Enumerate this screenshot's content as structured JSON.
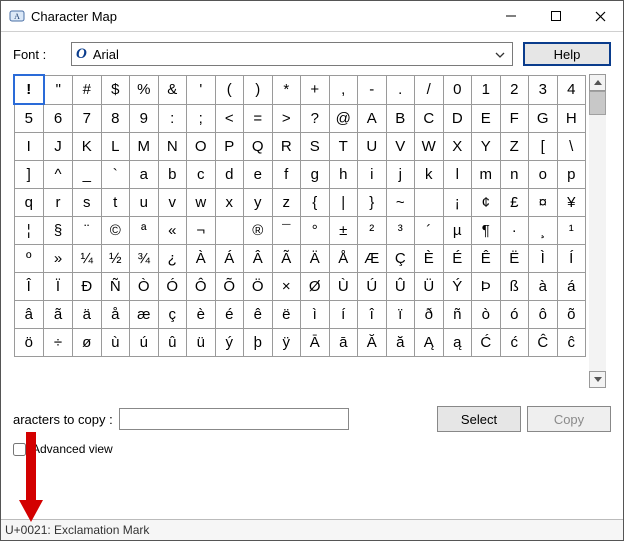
{
  "window": {
    "title": "Character Map"
  },
  "toolbar": {
    "font_label": "Font :",
    "font_name": "Arial",
    "help_label": "Help"
  },
  "grid": {
    "selected_index": 0,
    "rows": [
      [
        "!",
        "\"",
        "#",
        "$",
        "%",
        "&",
        "'",
        "(",
        ")",
        "*",
        "+",
        ",",
        "-",
        ".",
        "/",
        "0",
        "1",
        "2",
        "3",
        "4"
      ],
      [
        "5",
        "6",
        "7",
        "8",
        "9",
        ":",
        ";",
        "<",
        "=",
        ">",
        "?",
        "@",
        "A",
        "B",
        "C",
        "D",
        "E",
        "F",
        "G",
        "H"
      ],
      [
        "I",
        "J",
        "K",
        "L",
        "M",
        "N",
        "O",
        "P",
        "Q",
        "R",
        "S",
        "T",
        "U",
        "V",
        "W",
        "X",
        "Y",
        "Z",
        "[",
        "\\"
      ],
      [
        "]",
        "^",
        "_",
        "`",
        "a",
        "b",
        "c",
        "d",
        "e",
        "f",
        "g",
        "h",
        "i",
        "j",
        "k",
        "l",
        "m",
        "n",
        "o",
        "p"
      ],
      [
        "q",
        "r",
        "s",
        "t",
        "u",
        "v",
        "w",
        "x",
        "y",
        "z",
        "{",
        "|",
        "}",
        "~",
        "",
        "¡",
        "¢",
        "£",
        "¤",
        "¥"
      ],
      [
        "¦",
        "§",
        "¨",
        "©",
        "ª",
        "«",
        "¬",
        "­",
        "®",
        "¯",
        "°",
        "±",
        "²",
        "³",
        "´",
        "µ",
        "¶",
        "·",
        "¸",
        "¹"
      ],
      [
        "º",
        "»",
        "¼",
        "½",
        "¾",
        "¿",
        "À",
        "Á",
        "Â",
        "Ã",
        "Ä",
        "Å",
        "Æ",
        "Ç",
        "È",
        "É",
        "Ê",
        "Ë",
        "Ì",
        "Í"
      ],
      [
        "Î",
        "Ï",
        "Ð",
        "Ñ",
        "Ò",
        "Ó",
        "Ô",
        "Õ",
        "Ö",
        "×",
        "Ø",
        "Ù",
        "Ú",
        "Û",
        "Ü",
        "Ý",
        "Þ",
        "ß",
        "à",
        "á"
      ],
      [
        "â",
        "ã",
        "ä",
        "å",
        "æ",
        "ç",
        "è",
        "é",
        "ê",
        "ë",
        "ì",
        "í",
        "î",
        "ï",
        "ð",
        "ñ",
        "ò",
        "ó",
        "ô",
        "õ"
      ],
      [
        "ö",
        "÷",
        "ø",
        "ù",
        "ú",
        "û",
        "ü",
        "ý",
        "þ",
        "ÿ",
        "Ā",
        "ā",
        "Ă",
        "ă",
        "Ą",
        "ą",
        "Ć",
        "ć",
        "Ĉ",
        "ĉ"
      ]
    ]
  },
  "copy": {
    "label": "aracters to copy :",
    "value": "",
    "select_label": "Select",
    "copy_label": "Copy"
  },
  "advanced": {
    "label": "Advanced view",
    "checked": false
  },
  "status": {
    "text": "U+0021: Exclamation Mark"
  },
  "icons": {
    "font_glyph": "O"
  }
}
